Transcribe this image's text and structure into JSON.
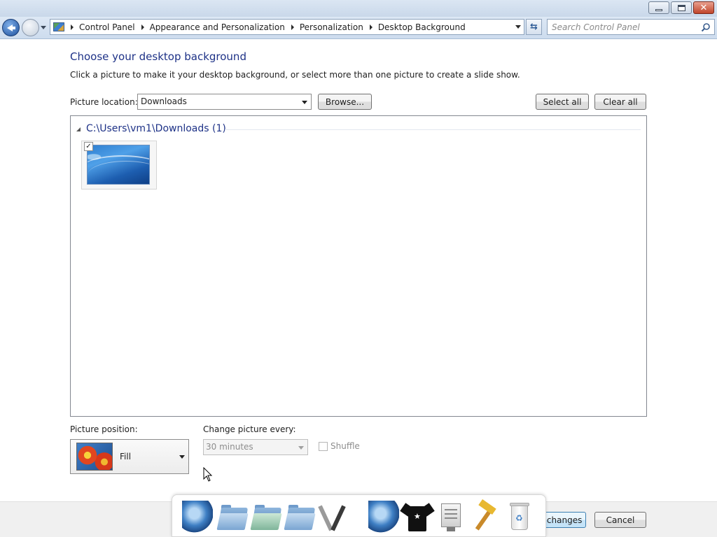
{
  "window": {
    "minimize_label": "",
    "maximize_label": "",
    "close_label": "✕"
  },
  "address": {
    "breadcrumbs": [
      "Control Panel",
      "Appearance and Personalization",
      "Personalization",
      "Desktop Background"
    ],
    "search_placeholder": "Search Control Panel"
  },
  "page": {
    "title": "Choose your desktop background",
    "instructions": "Click a picture to make it your desktop background, or select more than one picture to create a slide show.",
    "picture_location_label": "Picture location:",
    "picture_location_value": "Downloads",
    "browse_button": "Browse...",
    "select_all_button": "Select all",
    "clear_all_button": "Clear all"
  },
  "gallery": {
    "group_label": "C:\\Users\\vm1\\Downloads (1)",
    "items": [
      {
        "checked": true,
        "check_mark": "✓"
      }
    ]
  },
  "options": {
    "position_label": "Picture position:",
    "position_value": "Fill",
    "interval_label": "Change picture every:",
    "interval_value": "30 minutes",
    "shuffle_label": "Shuffle",
    "shuffle_checked": false
  },
  "footer": {
    "save_button": "Save changes",
    "cancel_button": "Cancel"
  },
  "dock": {
    "icons": [
      "globe-icon",
      "folder-icon",
      "music-folder-icon",
      "folder-icon",
      "tools-icon",
      "globe-icon",
      "tshirt-icon",
      "document-monitor-icon",
      "hammer-icon",
      "recycle-bin-icon"
    ]
  },
  "colors": {
    "heading": "#1e3287",
    "titlebar": "#dbe6f3",
    "footer": "#f0f0f0"
  }
}
